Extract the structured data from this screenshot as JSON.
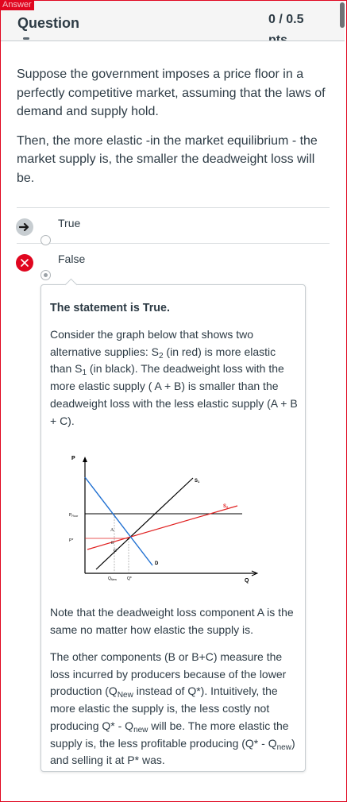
{
  "page": {
    "answer_tag": "Answer"
  },
  "header": {
    "title": "Question",
    "points_line1": "0 / 0.5",
    "points_line2": "pts"
  },
  "question": {
    "paragraph1": "Suppose the government imposes a price floor in a perfectly competitive market, assuming that the laws of demand and supply hold.",
    "paragraph2": "Then, the more elastic -in the market equilibrium - the market supply is, the smaller the deadweight loss will be."
  },
  "answers": [
    {
      "label": "True",
      "icon": "arrow-right-icon",
      "marker": "correct-answer",
      "selected": false
    },
    {
      "label": "False",
      "icon": "x-icon",
      "marker": "wrong-selection",
      "selected": true
    }
  ],
  "feedback": {
    "heading": "The statement is True.",
    "p1_a": "Consider the graph below that shows two alternative supplies: S",
    "p1_s2": "2",
    "p1_b": " (in red) is more elastic than S",
    "p1_s1": "1",
    "p1_c": " (in black). The deadweight loss with the more elastic supply ( A + B) is smaller than the deadweight loss with the less elastic supply (A + B + C).",
    "p2": "Note that the deadweight loss component A is the same no matter how elastic the supply is.",
    "p3_a": "The other components (B or B+C) measure the loss incurred by producers because of the lower production (Q",
    "p3_new1": "New",
    "p3_b": " instead of Q*). Intuitively, the more elastic the supply is, the less costly not producing Q* - Q",
    "p3_new2": "new",
    "p3_c": " will be. The more elastic the supply is, the less profitable producing (Q* - Q",
    "p3_new3": "new",
    "p3_d": ") and selling it at P* was."
  },
  "graph": {
    "y_axis": "P",
    "x_axis": "Q",
    "pfloor": "P",
    "pfloor_sub": "Floor",
    "pstar": "P*",
    "s1": "S",
    "s1_sub": "1",
    "s2": "S",
    "s2_sub": "2",
    "demand": "D",
    "area_a": "A",
    "area_b": "B",
    "area_c": "C",
    "qnew": "Q",
    "qnew_sub": "New",
    "qstar": "Q*",
    "colors": {
      "s2": "#e02020",
      "demand": "#1f6fd1",
      "s1": "#000000",
      "floor": "#000000"
    }
  },
  "colors": {
    "accent_red": "#e0061f",
    "text": "#2d3b45"
  }
}
